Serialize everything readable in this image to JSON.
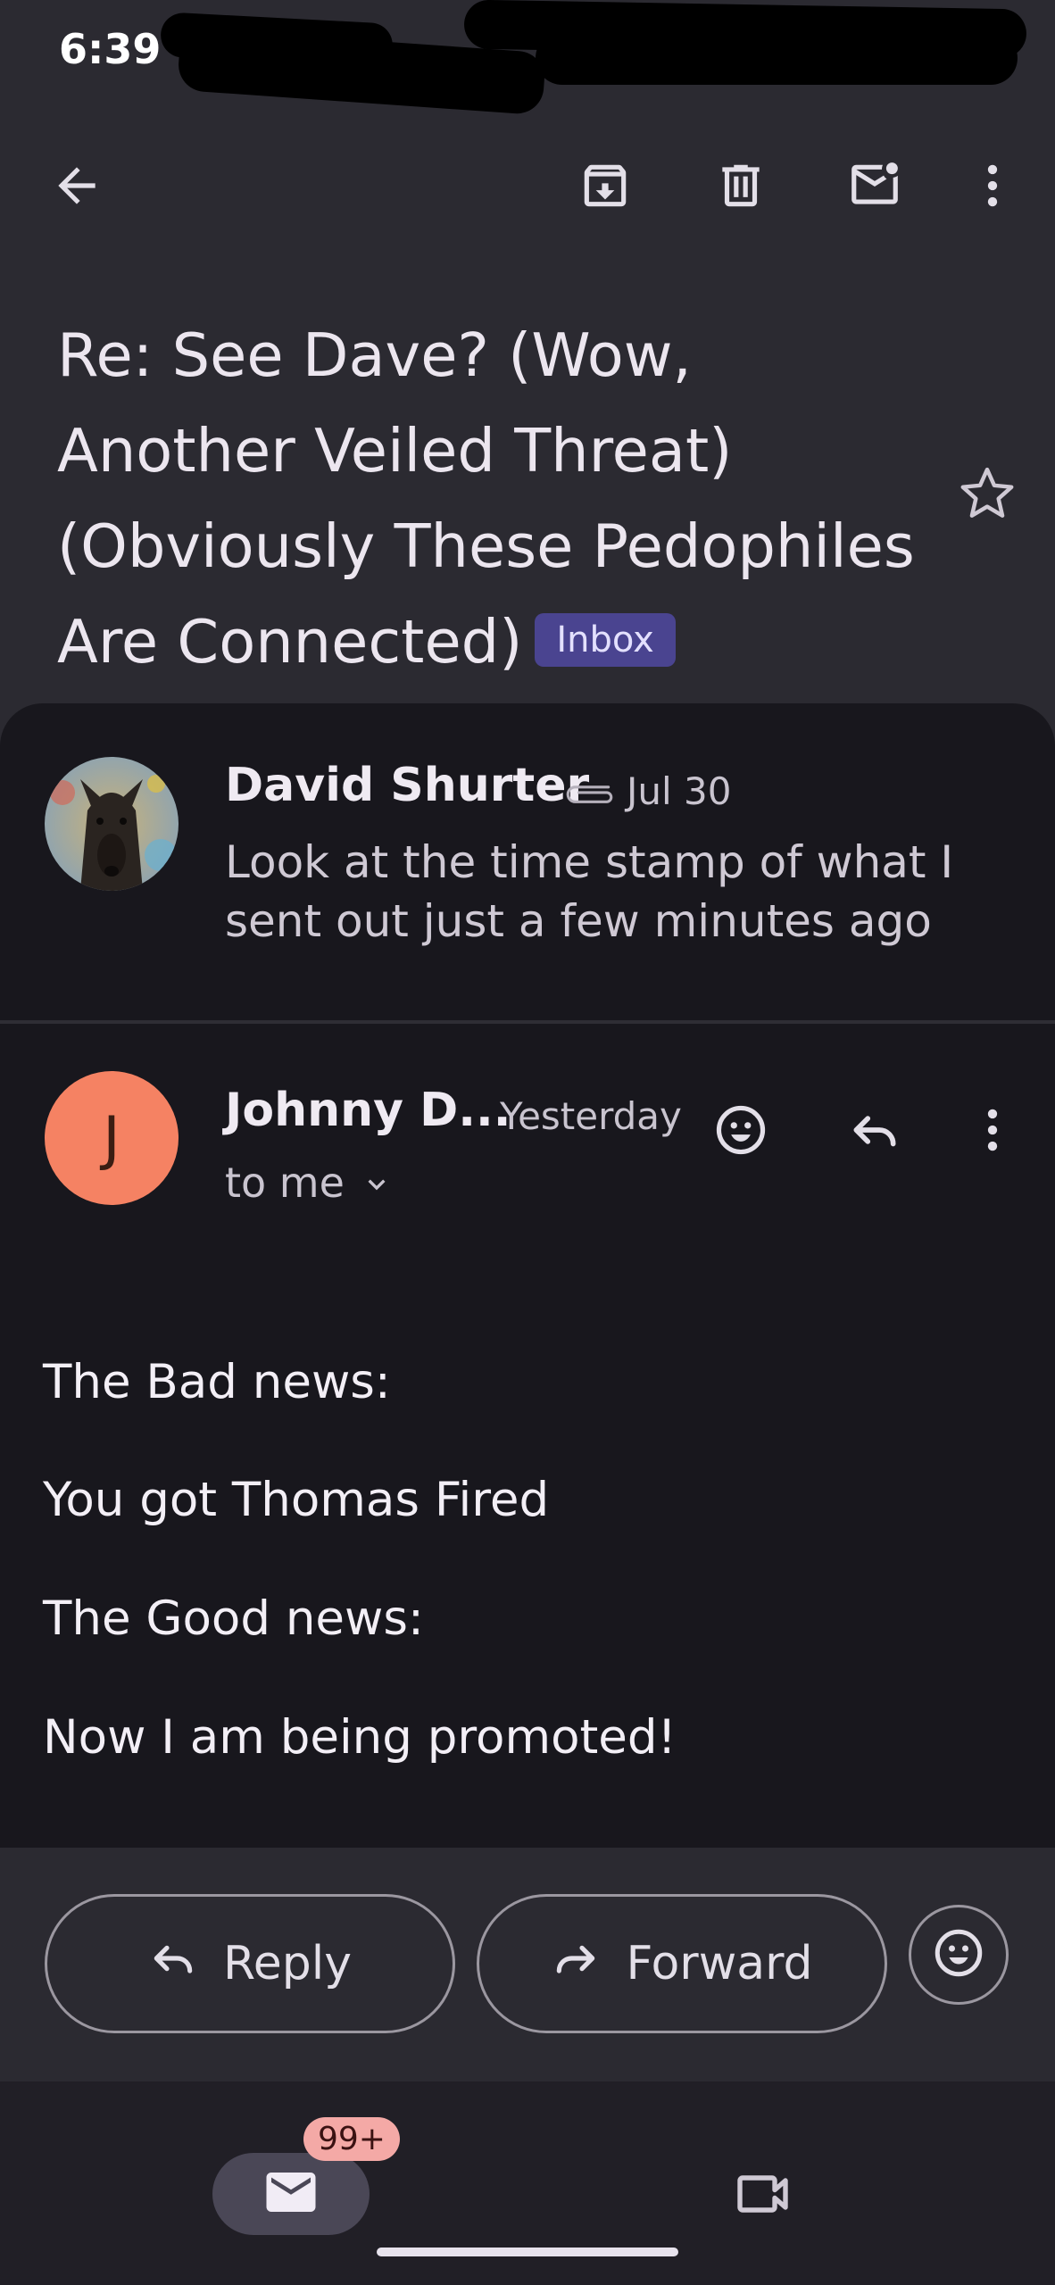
{
  "status_bar": {
    "time": "6:39"
  },
  "toolbar": {
    "back": "back-arrow-icon",
    "archive": "archive-icon",
    "delete": "trash-icon",
    "mark_unread": "mark-unread-icon",
    "more": "more-vert-icon"
  },
  "email": {
    "subject": "Re: See Dave? (Wow, Another Veiled Threat) (Obviously These Pedophiles Are Connected)",
    "label": "Inbox"
  },
  "messages": [
    {
      "sender": "David Shurter",
      "date": "Jul 30",
      "snippet": "Look at the time stamp of what I sent out just a few minutes ago",
      "has_attachment": true
    },
    {
      "sender": "Johnny D...",
      "avatar_letter": "J",
      "date": "Yesterday",
      "recipient": "to me",
      "body": [
        "The Bad news:",
        "You got Thomas Fired",
        "The Good news:",
        "Now I am being promoted!"
      ]
    }
  ],
  "actions": {
    "reply": "Reply",
    "forward": "Forward"
  },
  "bottom_nav": {
    "mail_badge": "99+"
  },
  "colors": {
    "background": "#2b2a31",
    "thread_background": "#18171d",
    "label_badge": "#4a4490",
    "avatar_j": "#f58263",
    "count_badge": "#f4a9a6"
  }
}
